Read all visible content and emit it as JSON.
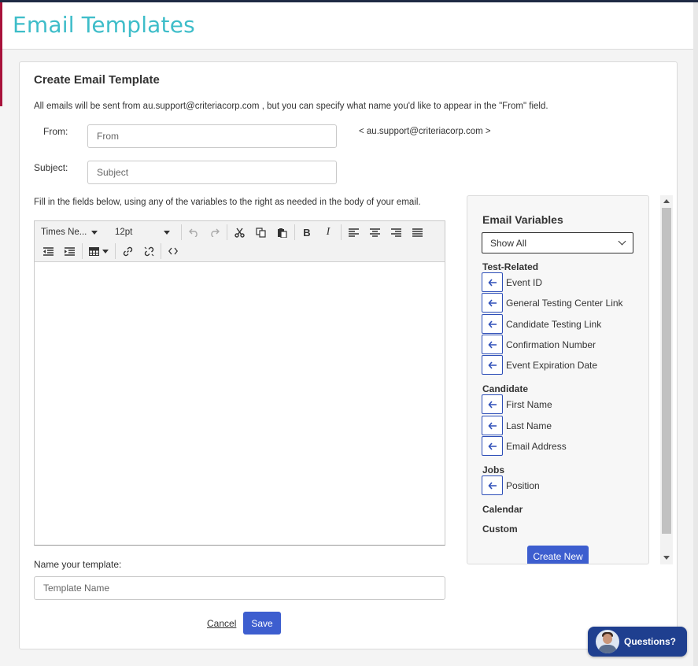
{
  "header": {
    "title": "Email Templates"
  },
  "card": {
    "title": "Create Email Template",
    "intro": "All emails will be sent from au.support@criteriacorp.com , but you can specify what name you'd like to appear in the \"From\" field.",
    "from_label": "From:",
    "from_placeholder": "From",
    "from_email": "< au.support@criteriacorp.com >",
    "subject_label": "Subject:",
    "subject_placeholder": "Subject",
    "fill_note": "Fill in the fields below, using any of the variables to the right as needed in the body of your email."
  },
  "toolbar": {
    "font_family": "Times Ne...",
    "font_size": "12pt"
  },
  "variables": {
    "title": "Email Variables",
    "filter_selected": "Show All",
    "groups": [
      {
        "title": "Test-Related",
        "items": [
          "Event ID",
          "General Testing Center Link",
          "Candidate Testing Link",
          "Confirmation Number",
          "Event Expiration Date"
        ]
      },
      {
        "title": "Candidate",
        "items": [
          "First Name",
          "Last Name",
          "Email Address"
        ]
      },
      {
        "title": "Jobs",
        "items": [
          "Position"
        ]
      },
      {
        "title": "Calendar",
        "items": []
      },
      {
        "title": "Custom",
        "items": []
      }
    ],
    "create_new_label": "Create New"
  },
  "template_name": {
    "label": "Name your template:",
    "placeholder": "Template Name"
  },
  "actions": {
    "cancel_label": "Cancel",
    "save_label": "Save"
  },
  "chat": {
    "label": "Questions?"
  },
  "colors": {
    "title_teal": "#3ebdc9",
    "primary_blue": "#3d5ecf",
    "chat_navy": "#1f3f8f",
    "accent_red": "#a8123b"
  }
}
